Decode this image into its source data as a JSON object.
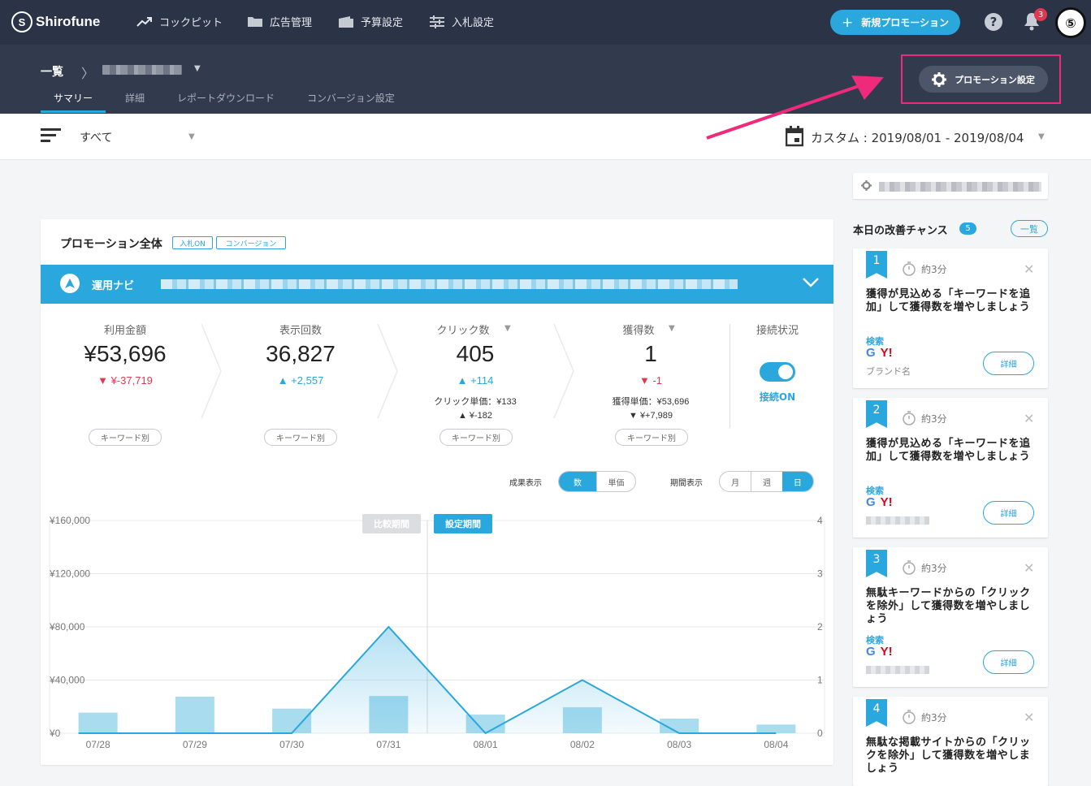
{
  "app": {
    "name": "Shirofune"
  },
  "nav": {
    "items": [
      {
        "label": "コックピット",
        "icon": "trend-icon"
      },
      {
        "label": "広告管理",
        "icon": "folder-icon"
      },
      {
        "label": "予算設定",
        "icon": "wallet-icon"
      },
      {
        "label": "入札設定",
        "icon": "sliders-icon"
      }
    ]
  },
  "header": {
    "new_promo": "新規プロモーション",
    "help": "?",
    "notifications": "3"
  },
  "breadcrumb": {
    "root": "一覧"
  },
  "subtabs": [
    "サマリー",
    "詳細",
    "レポートダウンロード",
    "コンバージョン設定"
  ],
  "promo_settings": "プロモーション設定",
  "filter": {
    "value": "すべて"
  },
  "date_range": "カスタム : 2019/08/01 - 2019/08/04",
  "panel": {
    "title": "プロモーション全体",
    "tags": [
      "入札ON",
      "コンバージョン"
    ],
    "navi_label": "運用ナビ"
  },
  "metrics": [
    {
      "label": "利用金額",
      "value": "¥53,696",
      "delta": "¥-37,719",
      "direction": "down",
      "button": "キーワード別"
    },
    {
      "label": "表示回数",
      "value": "36,827",
      "delta": "+2,557",
      "direction": "up",
      "button": "キーワード別"
    },
    {
      "label": "クリック数",
      "value": "405",
      "delta": "+114",
      "direction": "up",
      "sub": "クリック単価：¥133",
      "sub_delta": "¥-182",
      "sub_direction": "up",
      "button": "キーワード別"
    },
    {
      "label": "獲得数",
      "value": "1",
      "delta": "-1",
      "direction": "down",
      "sub": "獲得単価：¥53,696",
      "sub_delta": "¥+7,989",
      "sub_direction": "down",
      "button": "キーワード別"
    }
  ],
  "connection": {
    "label": "接続状況",
    "status": "接続ON",
    "on": true
  },
  "display_controls": {
    "result_label": "成果表示",
    "result_options": [
      "数",
      "単価"
    ],
    "result_selected": "数",
    "period_label": "期間表示",
    "period_options": [
      "月",
      "週",
      "日"
    ],
    "period_selected": "日"
  },
  "chart_data": {
    "type": "bar",
    "categories": [
      "07/28",
      "07/29",
      "07/30",
      "07/31",
      "08/01",
      "08/02",
      "08/03",
      "08/04"
    ],
    "y_ticks_left": [
      "¥160,000",
      "¥120,000",
      "¥80,000",
      "¥40,000",
      "¥0"
    ],
    "y_ticks_right": [
      "4",
      "3",
      "2",
      "1",
      "0"
    ],
    "ylim": [
      0,
      160000
    ],
    "y2lim": [
      0,
      4
    ],
    "series": [
      {
        "kind": "bar",
        "axis": "left",
        "values": [
          15500,
          27500,
          18500,
          28000,
          14000,
          19500,
          11000,
          6500
        ]
      },
      {
        "kind": "line",
        "axis": "right",
        "values": [
          0,
          0,
          0,
          2,
          0,
          1,
          0,
          0
        ]
      }
    ],
    "period_markers": [
      {
        "label": "比較期間",
        "style": "muted"
      },
      {
        "label": "設定期間",
        "style": "accent"
      }
    ],
    "grid": true
  },
  "chances": {
    "title": "本日の改善チャンス",
    "count": "5",
    "list_button": "一覧",
    "cards": [
      {
        "num": "1",
        "time": "約3分",
        "title": "獲得が見込める「キーワードを追加」して獲得数を増やしましょう",
        "category": "検索",
        "logos": [
          "G",
          "Y!"
        ],
        "brand": "ブランド名",
        "button": "詳細"
      },
      {
        "num": "2",
        "time": "約3分",
        "title": "獲得が見込める「キーワードを追加」して獲得数を増やしましょう",
        "category": "検索",
        "logos": [
          "G",
          "Y!"
        ],
        "button": "詳細"
      },
      {
        "num": "3",
        "time": "約3分",
        "title": "無駄キーワードからの「クリックを除外」して獲得数を増やしましょう",
        "category": "検索",
        "logos": [
          "G",
          "Y!"
        ],
        "button": "詳細"
      },
      {
        "num": "4",
        "time": "約3分",
        "title": "無駄な掲載サイトからの「クリックを除外」して獲得数を増やしましょう"
      }
    ]
  },
  "colors": {
    "accent": "#2aa7dc",
    "negative": "#e0394f",
    "topbar": "#2b3346",
    "highlight": "#ee2a7b"
  }
}
